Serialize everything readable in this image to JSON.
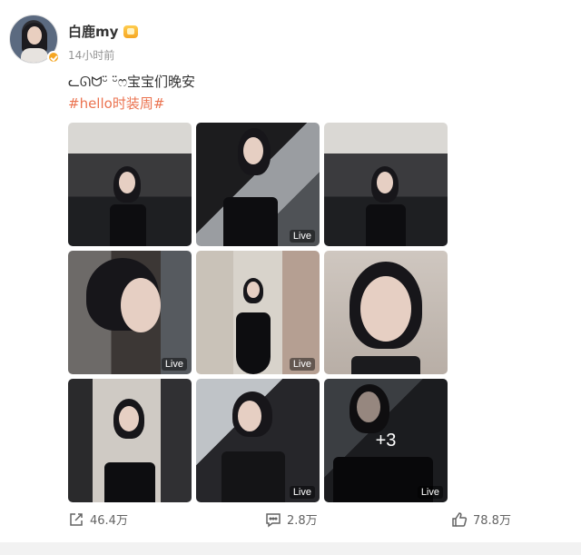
{
  "user": {
    "name": "白鹿my",
    "badge_icon": "member-crown-icon",
    "verified_icon": "verified-check-icon",
    "time": "14小时前"
  },
  "post": {
    "text": "ᓚᘏᗢᵕ̈ ᵕ̈ෆ宝宝们晚安",
    "hashtag": "#hello时装周#"
  },
  "images": [
    {
      "live": false
    },
    {
      "live": true,
      "label": "Live"
    },
    {
      "live": false
    },
    {
      "live": true,
      "label": "Live"
    },
    {
      "live": true,
      "label": "Live"
    },
    {
      "live": false
    },
    {
      "live": false
    },
    {
      "live": true,
      "label": "Live"
    },
    {
      "live": true,
      "label": "Live",
      "more": "+3"
    }
  ],
  "actions": {
    "repost": "46.4万",
    "comment": "2.8万",
    "like": "78.8万"
  },
  "colors": {
    "hashtag": "#eb7350",
    "meta": "#939393",
    "badge": "#f5a623"
  }
}
